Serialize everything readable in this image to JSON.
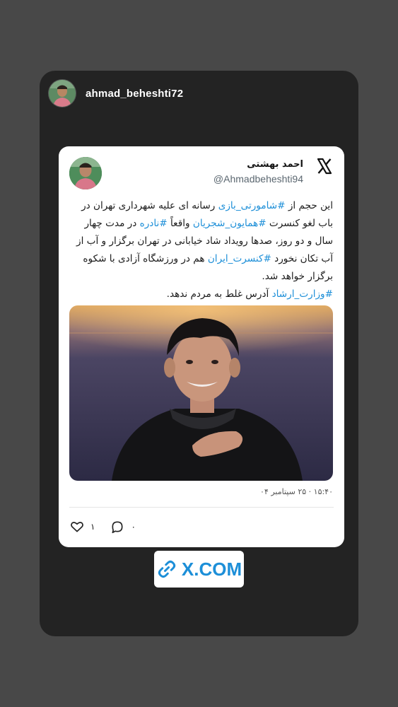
{
  "story": {
    "username": "ahmad_beheshti72"
  },
  "tweet": {
    "author_name": "احمد بهشتی",
    "author_handle": "@Ahmadbeheshti94",
    "text_segments": [
      {
        "t": "این حجم از ",
        "tag": false
      },
      {
        "t": "#شامورتی_بازی",
        "tag": true
      },
      {
        "t": " رسانه ای علیه شهرداری تهران در باب لغو کنسرت ",
        "tag": false
      },
      {
        "t": "#همایون_شجریان",
        "tag": true
      },
      {
        "t": " واقعاً ",
        "tag": false
      },
      {
        "t": "#نادره",
        "tag": true
      },
      {
        "t": " در مدت چهار سال و دو روز، صدها رویداد شاد خیابانی در تهران برگزار و آب از آب تکان نخورد ",
        "tag": false
      },
      {
        "t": "#کنسرت_ایران",
        "tag": true
      },
      {
        "t": " هم در ورزشگاه آزادی با شکوه برگزار خواهد شد.",
        "tag": false
      },
      {
        "t": "\n",
        "tag": false
      },
      {
        "t": "#وزارت_ارشاد",
        "tag": true
      },
      {
        "t": " آدرس غلط به مردم ندهد.",
        "tag": false
      }
    ],
    "timestamp": "۱۵:۴۰ · ۲۵ سپتامبر ۰۴",
    "likes": "۱",
    "replies": "۰"
  },
  "link_button": {
    "label": "X.COM"
  },
  "colors": {
    "accent": "#1d8fd8",
    "story_bg": "#232323",
    "page_bg": "#484848"
  },
  "icons": [
    "x-logo-icon",
    "heart-icon",
    "reply-icon",
    "link-icon"
  ]
}
